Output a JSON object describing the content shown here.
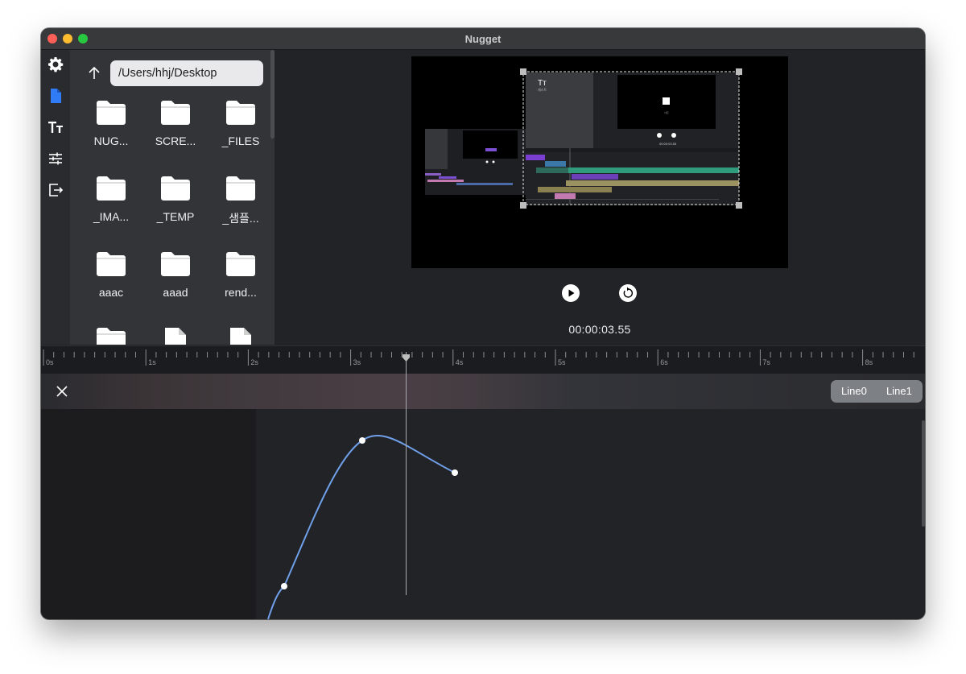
{
  "window": {
    "title": "Nugget"
  },
  "rail": {
    "items": [
      "settings-icon",
      "file-icon",
      "text-icon",
      "sliders-icon",
      "export-icon"
    ],
    "active_color": "#2f7cf6"
  },
  "browser": {
    "path": "/Users/hhj/Desktop",
    "items": [
      {
        "label": "NUG...",
        "kind": "folder"
      },
      {
        "label": "SCRE...",
        "kind": "folder"
      },
      {
        "label": "_FILES",
        "kind": "folder"
      },
      {
        "label": "_IMA...",
        "kind": "folder"
      },
      {
        "label": "_TEMP",
        "kind": "folder"
      },
      {
        "label": "_샘플...",
        "kind": "folder"
      },
      {
        "label": "aaac",
        "kind": "folder"
      },
      {
        "label": "aaad",
        "kind": "folder"
      },
      {
        "label": "rend...",
        "kind": "folder"
      },
      {
        "label": "",
        "kind": "folder"
      },
      {
        "label": "",
        "kind": "file"
      },
      {
        "label": "",
        "kind": "file"
      }
    ]
  },
  "preview": {
    "timecode": "00:00:03.55",
    "inner_timecode": "00:00:03.55"
  },
  "ruler": {
    "labels": [
      "0s",
      "1s",
      "2s",
      "3s",
      "4s",
      "5s",
      "6s",
      "7s",
      "8s"
    ]
  },
  "keyframes": {
    "tabs": [
      "Line0",
      "Line1"
    ],
    "curve_color": "#6f9fe8"
  }
}
